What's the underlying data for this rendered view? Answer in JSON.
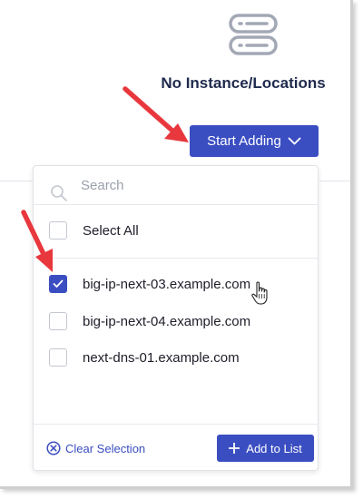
{
  "empty_state": {
    "title": "No Instance/Locations",
    "icon": "server-stack-icon"
  },
  "start_button": {
    "label": "Start Adding",
    "icon": "chevron-down-icon"
  },
  "dropdown": {
    "search_placeholder": "Search",
    "select_all_label": "Select All",
    "select_all_checked": false,
    "items": [
      {
        "label": "big-ip-next-03.example.com",
        "checked": true
      },
      {
        "label": "big-ip-next-04.example.com",
        "checked": false
      },
      {
        "label": "next-dns-01.example.com",
        "checked": false
      }
    ],
    "clear_label": "Clear Selection",
    "add_label": "Add to List"
  },
  "colors": {
    "accent": "#3b4ec1",
    "annotation_arrow": "#e8383d",
    "title_text": "#1f2a4d",
    "icon_gray": "#a3a8b5"
  }
}
